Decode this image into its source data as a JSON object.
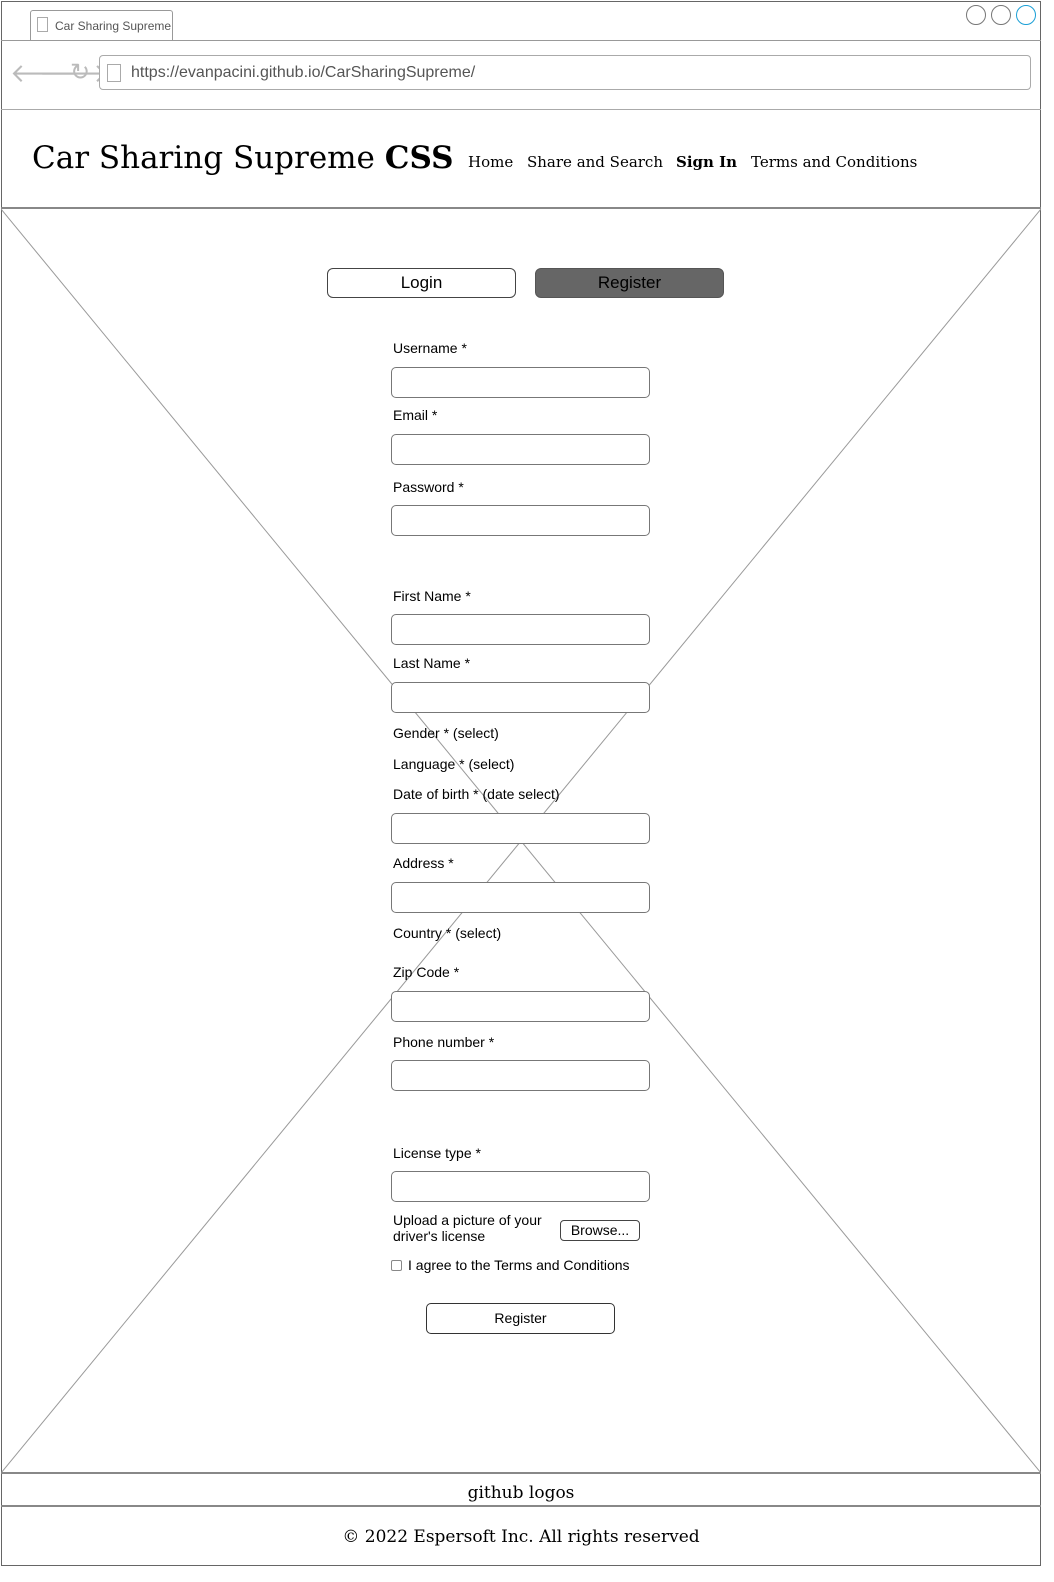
{
  "browser": {
    "tab_title": "Car Sharing Supreme",
    "url": "https://evanpacini.github.io/CarSharingSupreme/",
    "back_icon": "arrow-left-icon",
    "forward_icon": "arrow-right-icon",
    "reload_icon": "reload-icon"
  },
  "header": {
    "brand_name": "Car Sharing Supreme",
    "brand_suffix": "CSS",
    "nav": {
      "home": "Home",
      "share_search": "Share and Search",
      "sign_in": "Sign In",
      "terms": "Terms and Conditions"
    },
    "active_nav": "Sign In"
  },
  "auth_toggle": {
    "login": "Login",
    "register": "Register",
    "selected": "Register"
  },
  "form": {
    "username_label": "Username *",
    "email_label": "Email *",
    "password_label": "Password *",
    "first_name_label": "First Name *",
    "last_name_label": "Last Name *",
    "gender_label": "Gender * (select)",
    "language_label": "Language * (select)",
    "dob_label": "Date of birth * (date select)",
    "address_label": "Address *",
    "country_label": "Country * (select)",
    "zip_label": "Zip Code *",
    "phone_label": "Phone number *",
    "license_type_label": "License type *",
    "upload_label_line1": "Upload a picture of your",
    "upload_label_line2": "driver's license",
    "browse_button": "Browse...",
    "agree_label": "I agree to the Terms and Conditions",
    "submit_button": "Register"
  },
  "footer": {
    "logos": "github logos",
    "copyright": "© 2022 Espersoft Inc. All rights reserved"
  },
  "colors": {
    "selected_toggle": "#666666",
    "window_control_accent": "#1a9fd6",
    "border": "#777777"
  }
}
